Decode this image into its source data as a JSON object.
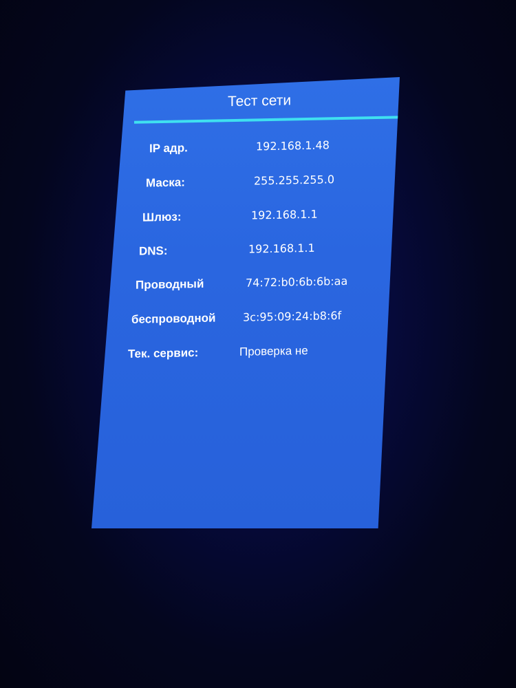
{
  "screen": {
    "title": "Тест сети",
    "rows": [
      {
        "label": "IP адр.",
        "value": "192.168.1.48"
      },
      {
        "label": "Маска:",
        "value": "255.255.255.0"
      },
      {
        "label": "Шлюз:",
        "value": "192.168.1.1"
      },
      {
        "label": "DNS:",
        "value": "192.168.1.1"
      },
      {
        "label": "Проводный",
        "value": "74:72:b0:6b:6b:aa"
      },
      {
        "label": "беспроводной",
        "value": "3c:95:09:24:b8:6f"
      },
      {
        "label": "Тек. сервис:",
        "value": "Проверка не"
      }
    ]
  },
  "colors": {
    "background": "#2a66e0",
    "accent_rule": "#3fe0f0",
    "text": "#ffffff"
  }
}
